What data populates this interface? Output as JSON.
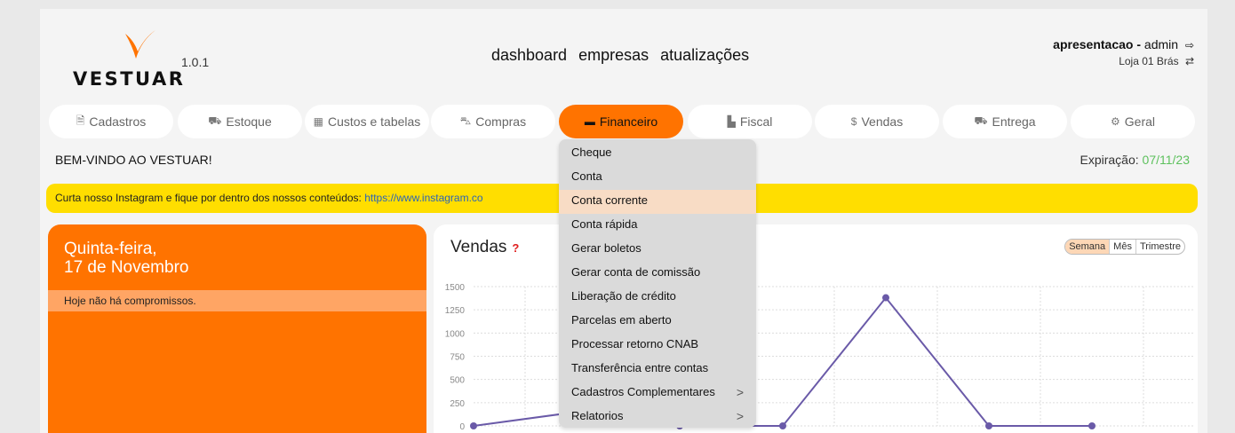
{
  "header": {
    "logo_text": "VESTUAR",
    "version": "1.0.1",
    "nav": [
      "dashboard",
      "empresas",
      "atualizações"
    ],
    "company": "apresentacao",
    "separator": "-",
    "user": "admin",
    "store": "Loja 01 Brás",
    "logout_icon": "sign-out-icon",
    "swap_icon": "retweet-icon"
  },
  "menu": [
    {
      "label": "Cadastros",
      "icon": "file-icon",
      "glyph": "🗎"
    },
    {
      "label": "Estoque",
      "icon": "truck-icon",
      "glyph": "⛟"
    },
    {
      "label": "Custos e tabelas",
      "icon": "table-icon",
      "glyph": "▦"
    },
    {
      "label": "Compras",
      "icon": "cart-icon",
      "glyph": "⛍"
    },
    {
      "label": "Financeiro",
      "icon": "credit-card-icon",
      "glyph": "▬"
    },
    {
      "label": "Fiscal",
      "icon": "file-icon",
      "glyph": "▙"
    },
    {
      "label": "Vendas",
      "icon": "dollar-icon",
      "glyph": "$"
    },
    {
      "label": "Entrega",
      "icon": "truck-icon",
      "glyph": "⛟"
    },
    {
      "label": "Geral",
      "icon": "cogs-icon",
      "glyph": "⚙"
    }
  ],
  "active_menu": "Financeiro",
  "welcome": "BEM-VINDO AO VESTUAR!",
  "expiration_label": "Expiração:",
  "expiration_date": "07/11/23",
  "banner": {
    "text": "Curta nosso Instagram e fique por dentro dos nossos conteúdos: ",
    "link": "https://www.instagram.co"
  },
  "day_card": {
    "weekday": "Quinta-feira,",
    "date": "17 de Novembro",
    "note": "Hoje não há compromissos."
  },
  "sales": {
    "title": "Vendas",
    "help": "?",
    "periods": [
      "Semana",
      "Mês",
      "Trimestre"
    ],
    "active_period": "Semana"
  },
  "dropdown": [
    {
      "label": "Cheque"
    },
    {
      "label": "Conta"
    },
    {
      "label": "Conta corrente",
      "highlight": true
    },
    {
      "label": "Conta rápida"
    },
    {
      "label": "Gerar boletos"
    },
    {
      "label": "Gerar conta de comissão"
    },
    {
      "label": "Liberação de crédito"
    },
    {
      "label": "Parcelas em aberto"
    },
    {
      "label": "Processar retorno CNAB"
    },
    {
      "label": "Transferência entre contas"
    },
    {
      "label": "Cadastros Complementares",
      "submenu": true
    },
    {
      "label": "Relatorios",
      "submenu": true
    }
  ],
  "submenu_arrow": ">",
  "colors": {
    "accent": "#ff7300",
    "banner": "#ffde00",
    "line": "#6a5aa8",
    "ok": "#5dc15d"
  },
  "chart_data": {
    "type": "line",
    "x": [
      0,
      1,
      2,
      3,
      4,
      5,
      6
    ],
    "values": [
      0,
      150,
      0,
      0,
      1380,
      0,
      0
    ],
    "ylim": [
      0,
      1500
    ],
    "yticks": [
      0,
      250,
      500,
      750,
      1000,
      1250,
      1500
    ],
    "grid": true
  }
}
